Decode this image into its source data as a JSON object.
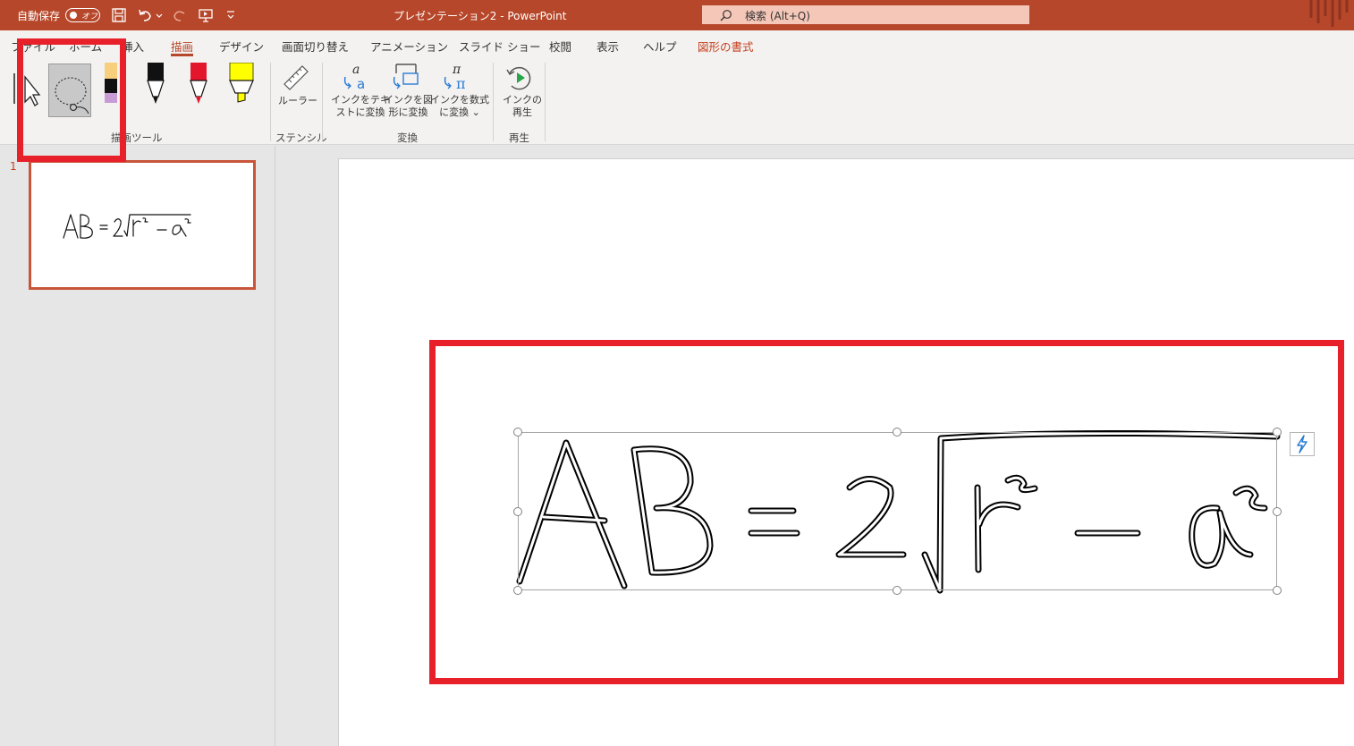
{
  "titlebar": {
    "autosave_label": "自動保存",
    "toggle_label": "オフ",
    "doc_title": "プレゼンテーション2  -  PowerPoint",
    "search_placeholder": "検索 (Alt+Q)"
  },
  "tabs": [
    {
      "label": "ファイル"
    },
    {
      "label": "ホーム"
    },
    {
      "label": "挿入"
    },
    {
      "label": "描画"
    },
    {
      "label": "デザイン"
    },
    {
      "label": "画面切り替え"
    },
    {
      "label": "アニメーション"
    },
    {
      "label": "スライド ショー"
    },
    {
      "label": "校閲"
    },
    {
      "label": "表示"
    },
    {
      "label": "ヘルプ"
    },
    {
      "label": "図形の書式"
    }
  ],
  "ribbon": {
    "groups": {
      "draw_tools": "描画ツール",
      "stencil": "ステンシル",
      "convert": "変換",
      "replay": "再生"
    },
    "ruler": "ルーラー",
    "ink_to_text": [
      "インクをテキ",
      "ストに変換"
    ],
    "ink_to_shape": [
      "インクを図",
      "形に変換"
    ],
    "ink_to_math": [
      "インクを数式",
      "に変換 ⌄"
    ],
    "ink_replay": [
      "インクの",
      "再生"
    ]
  },
  "slides_panel": {
    "slide_number": "1"
  },
  "colors": {
    "accent": "#b7472a",
    "annotation_red": "#e8202a",
    "search_bg": "#f5c7b8"
  }
}
